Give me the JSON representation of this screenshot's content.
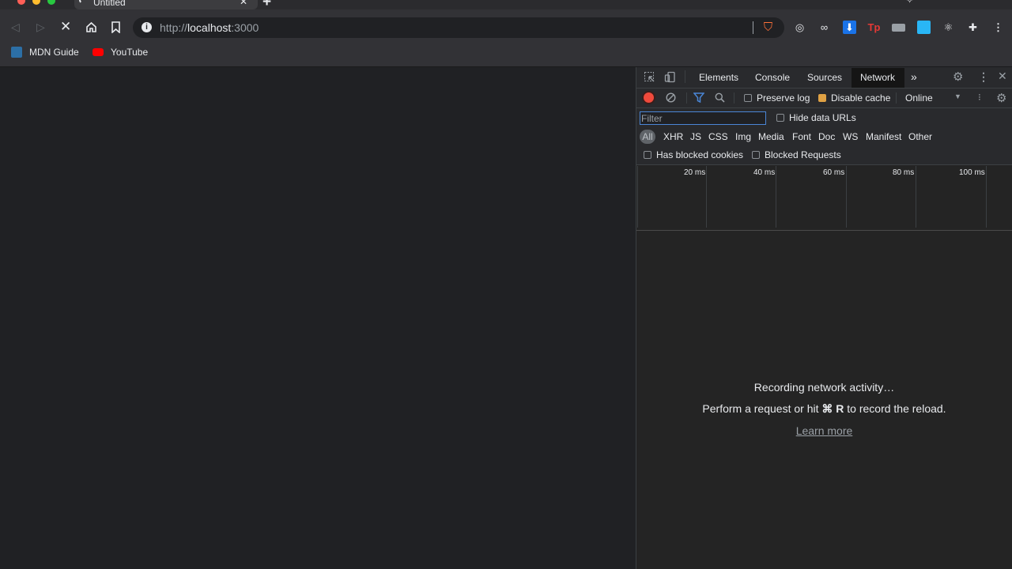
{
  "browser": {
    "tab": {
      "title": "Untitled",
      "close": "✕"
    },
    "new_tab": "+",
    "address": {
      "scheme": "http://",
      "host": "localhost",
      "port": ":3000"
    },
    "bookmarks": [
      {
        "label": "MDN Guide",
        "icon": "mdn-icon"
      },
      {
        "label": "YouTube",
        "icon": "youtube-icon"
      }
    ]
  },
  "devtools": {
    "tabs": [
      "Elements",
      "Console",
      "Sources",
      "Network"
    ],
    "active_tab": "Network",
    "more_tabs": "»",
    "toolbar": {
      "preserve_log": "Preserve log",
      "disable_cache": "Disable cache",
      "throttle": "Online"
    },
    "filter": {
      "placeholder": "Filter",
      "hide_data_urls": "Hide data URLs"
    },
    "types": [
      "All",
      "XHR",
      "JS",
      "CSS",
      "Img",
      "Media",
      "Font",
      "Doc",
      "WS",
      "Manifest",
      "Other"
    ],
    "blocked": {
      "has_blocked_cookies": "Has blocked cookies",
      "blocked_requests": "Blocked Requests"
    },
    "timeline_ticks": [
      "20 ms",
      "40 ms",
      "60 ms",
      "80 ms",
      "100 ms"
    ],
    "empty": {
      "title": "Recording network activity…",
      "hint_prefix": "Perform a request or hit",
      "hint_keys": "⌘ R",
      "hint_suffix": "to record the reload.",
      "learn_more": "Learn more"
    }
  },
  "colors": {
    "record": "#f04a3c",
    "filter_accent": "#4a86d6",
    "checkbox_on": "#e0a244"
  }
}
